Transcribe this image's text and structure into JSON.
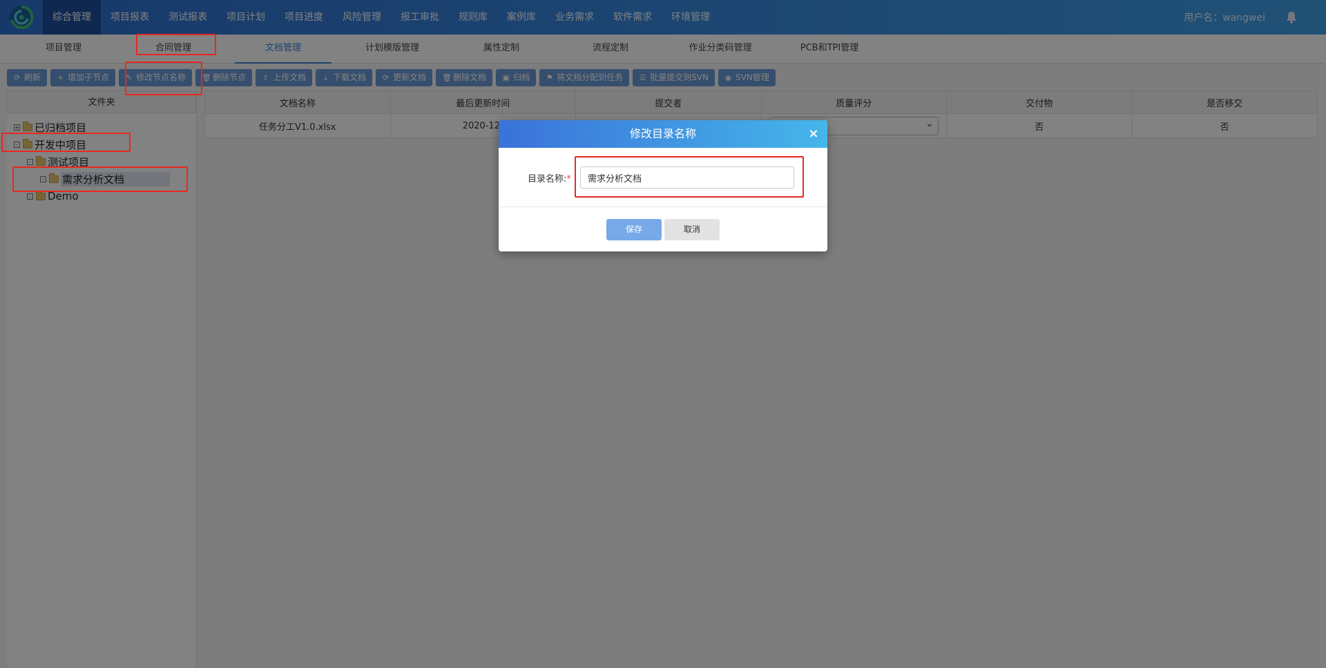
{
  "colors": {
    "topbar_left": "#2e6fd0",
    "topbar_right": "#3fa0e6",
    "toolbar_button": "#6b99d6",
    "annotation_red": "#e8281e",
    "active_tab": "#3a86d8"
  },
  "top_nav": {
    "items": [
      {
        "label": "综合管理"
      },
      {
        "label": "项目报表"
      },
      {
        "label": "测试报表"
      },
      {
        "label": "项目计划"
      },
      {
        "label": "项目进度"
      },
      {
        "label": "风险管理"
      },
      {
        "label": "报工审批"
      },
      {
        "label": "规则库"
      },
      {
        "label": "案例库"
      },
      {
        "label": "业务需求"
      },
      {
        "label": "软件需求"
      },
      {
        "label": "环境管理"
      }
    ],
    "active_index": 0,
    "user_label": "用户名：wangwei",
    "bell_icon": "bell-icon"
  },
  "sub_nav": {
    "tabs": [
      {
        "label": "项目管理"
      },
      {
        "label": "合同管理"
      },
      {
        "label": "文档管理"
      },
      {
        "label": "计划模版管理"
      },
      {
        "label": "属性定制"
      },
      {
        "label": "流程定制"
      },
      {
        "label": "作业分类码管理"
      },
      {
        "label": "PCB和TPI管理"
      }
    ],
    "active_index": 2
  },
  "toolbar": {
    "buttons": [
      {
        "label": "刷新",
        "icon": "refresh-icon"
      },
      {
        "label": "增加子节点",
        "icon": "plus-icon"
      },
      {
        "label": "修改节点名称",
        "icon": "edit-icon"
      },
      {
        "label": "删除节点",
        "icon": "trash-icon"
      },
      {
        "label": "上传文档",
        "icon": "upload-icon"
      },
      {
        "label": "下载文档",
        "icon": "download-icon"
      },
      {
        "label": "更新文档",
        "icon": "refresh-icon"
      },
      {
        "label": "删除文档",
        "icon": "trash-icon"
      },
      {
        "label": "归档",
        "icon": "archive-icon"
      },
      {
        "label": "将文档分配到任务",
        "icon": "flag-icon"
      },
      {
        "label": "批量提交到SVN",
        "icon": "list-icon"
      },
      {
        "label": "SVN管理",
        "icon": "eye-icon"
      }
    ]
  },
  "folder_panel": {
    "header": "文件夹",
    "tree": [
      {
        "label": "已归档项目",
        "toggle": "+"
      },
      {
        "label": "开发中项目",
        "toggle": "-"
      },
      {
        "label": "测试项目",
        "toggle": "-"
      },
      {
        "label": "需求分析文档",
        "toggle": "-"
      },
      {
        "label": "Demo",
        "toggle": "-"
      }
    ],
    "selected_index": 3
  },
  "table": {
    "columns": [
      "文档名称",
      "最后更新时间",
      "提交者",
      "质量评分",
      "交付物",
      "是否移交"
    ],
    "rows": [
      {
        "name": "任务分工V1.0.xlsx",
        "updated": "2020-12-",
        "submitter": "",
        "quality": "",
        "deliverable": "否",
        "handover": "否"
      }
    ]
  },
  "modal": {
    "title": "修改目录名称",
    "close_symbol": "×",
    "field_label": "目录名称:",
    "required_mark": "*",
    "field_value": "需求分析文档",
    "save_label": "保存",
    "cancel_label": "取消"
  }
}
